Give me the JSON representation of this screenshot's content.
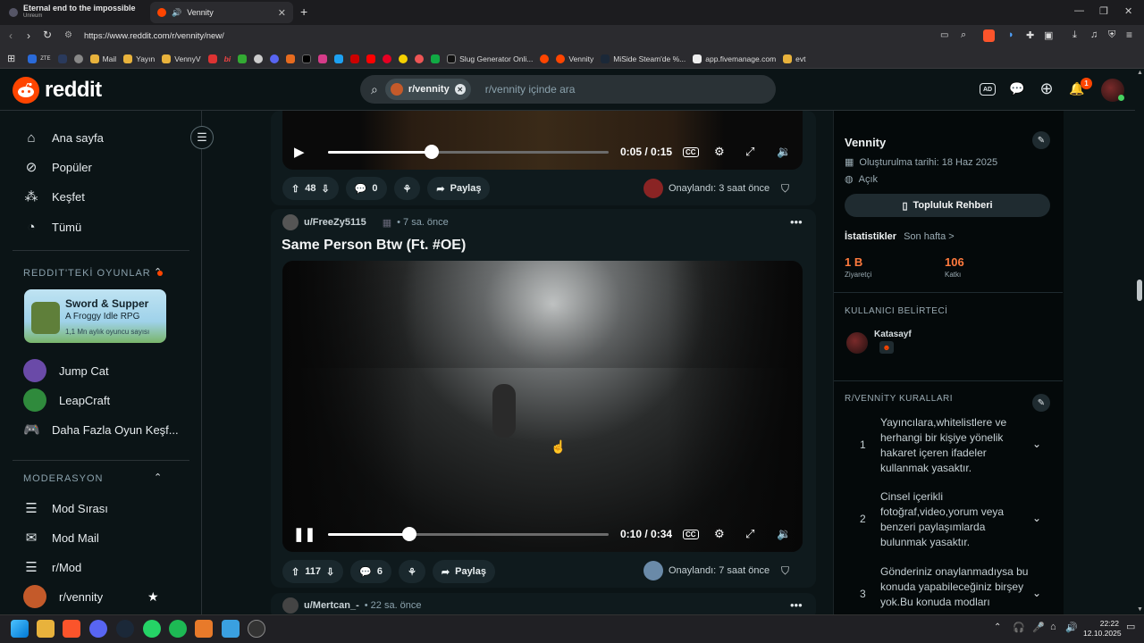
{
  "browser": {
    "tabs": [
      {
        "title": "Eternal end to the impossible",
        "subtitle": "Unreum"
      },
      {
        "title": "Vennity",
        "audio_icon": "speaker-icon"
      }
    ],
    "new_tab": "+",
    "url": "https://www.reddit.com/r/vennity/new/",
    "bookmarks": [
      "ZTE",
      "Mail",
      "Yayın",
      "VennyV",
      "bi",
      "Slug Generator Onli...",
      "Vennity",
      "MiSide Steam'de %...",
      "app.fivemanage.com",
      "evt"
    ]
  },
  "header": {
    "logo": "reddit",
    "search_chip": "r/vennity",
    "search_placeholder": "r/vennity içinde ara",
    "notification_count": "1"
  },
  "sidebar": {
    "items": [
      {
        "label": "Ana sayfa",
        "icon": "home-icon"
      },
      {
        "label": "Popüler",
        "icon": "popular-icon"
      },
      {
        "label": "Keşfet",
        "icon": "explore-icon"
      },
      {
        "label": "Tümü",
        "icon": "all-icon"
      }
    ],
    "games_title": "REDDIT'TEKİ OYUNLAR",
    "promo": {
      "title": "Sword & Supper",
      "subtitle": "A Froggy Idle RPG",
      "users": "1,1 Mn aylık oyuncu sayısı"
    },
    "games": [
      "Jump Cat",
      "LeapCraft",
      "Daha Fazla Oyun Keşf..."
    ],
    "mod_title": "MODERASYON",
    "mod_items": [
      "Mod Sırası",
      "Mod Mail",
      "r/Mod",
      "r/vennity"
    ]
  },
  "posts": [
    {
      "video": {
        "time": "0:05 / 0:15",
        "progress": 0.37
      },
      "votes": "48",
      "comments": "0",
      "share": "Paylaş",
      "approved": "Onaylandı: 3 saat önce"
    },
    {
      "user": "u/FreeZy5115",
      "time": "• 7 sa. önce",
      "title": "Same Person Btw (Ft. #OE)",
      "video": {
        "time": "0:10 / 0:34",
        "progress": 0.29
      },
      "votes": "117",
      "comments": "6",
      "share": "Paylaş",
      "approved": "Onaylandı: 7 saat önce"
    },
    {
      "user": "u/Mertcan_-",
      "time": "• 22 sa. önce"
    }
  ],
  "right": {
    "name": "Vennity",
    "created": "Oluşturulma tarihi: 18 Haz 2025",
    "visibility": "Açık",
    "guide_button": "Topluluk Rehberi",
    "stats_title": "İstatistikler",
    "stats_range": "Son hafta >",
    "visitors": "1 B",
    "visitors_label": "Ziyaretçi",
    "contributors": "106",
    "contributors_label": "Katkı",
    "flair_title": "KULLANICI BELİRTECİ",
    "flair_user": "Katasayf",
    "rules_title": "R/VENNİTY KURALLARI",
    "rules": [
      {
        "n": "1",
        "text": "Yayıncılara,whitelistlere ve herhangi bir kişiye yönelik hakaret içeren ifadeler kullanmak yasaktır."
      },
      {
        "n": "2",
        "text": "Cinsel içerikli fotoğraf,video,yorum veya benzeri paylaşımlarda bulunmak yasaktır."
      },
      {
        "n": "3",
        "text": "Gönderiniz onaylanmadıysa bu konuda yapabileceğiniz birşey yok.Bu konuda modları"
      }
    ]
  },
  "taskbar": {
    "time": "22:22",
    "date": "12.10.2025"
  }
}
